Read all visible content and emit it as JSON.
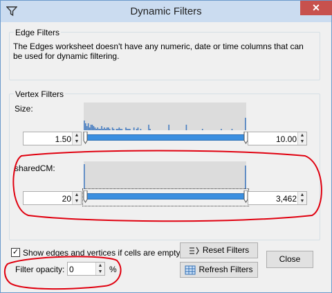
{
  "window": {
    "title": "Dynamic Filters",
    "filter_icon": "filter-icon",
    "close_icon": "close-icon",
    "close_glyph": "✕"
  },
  "edge_filters": {
    "title": "Edge Filters",
    "message_line1": "The Edges worksheet doesn't have any numeric, date or time columns that can",
    "message_line2": "be used for dynamic filtering."
  },
  "vertex_filters": {
    "title": "Vertex Filters",
    "filters": [
      {
        "label": "Size:",
        "min_value": "1.50",
        "max_value": "10.00",
        "range_low": 0,
        "range_high": 1,
        "histogram": [
          0.35,
          0.25,
          0.15,
          0.25,
          0.1,
          0.2,
          0.2,
          0.15,
          0.1,
          0.05,
          0.1,
          0.05,
          0.05,
          0.15,
          0.05,
          0.1,
          0.05,
          0.1,
          0.1,
          0.05,
          0,
          0.1,
          0.05,
          0,
          0.05,
          0.05,
          0.1,
          0.05,
          0.05,
          0,
          0,
          0.1,
          0.05,
          0.05,
          0.05,
          0,
          0,
          0.1,
          0,
          0.05,
          0.1,
          0,
          0.05,
          0,
          0,
          0,
          0,
          0,
          0.2,
          0.05,
          0,
          0,
          0,
          0,
          0,
          0,
          0,
          0,
          0,
          0,
          0,
          0,
          0,
          0.2,
          0,
          0,
          0,
          0,
          0,
          0,
          0,
          0,
          0,
          0,
          0,
          0,
          0.2,
          0,
          0,
          0,
          0,
          0,
          0,
          0,
          0,
          0,
          0,
          0,
          0.05,
          0,
          0,
          0,
          0,
          0,
          0,
          0,
          0,
          0,
          0,
          0,
          0,
          0,
          0.05,
          0,
          0,
          0,
          0,
          0,
          0,
          0,
          0.05,
          0,
          0,
          0,
          0,
          0,
          0,
          0,
          0,
          0,
          0.45
        ]
      },
      {
        "label": "sharedCM:",
        "min_value": "20",
        "max_value": "3,462",
        "range_low": 0,
        "range_high": 1,
        "histogram": [
          0.9,
          0,
          0,
          0,
          0,
          0,
          0,
          0,
          0,
          0,
          0,
          0,
          0,
          0,
          0,
          0,
          0,
          0,
          0,
          0,
          0,
          0,
          0,
          0,
          0,
          0,
          0,
          0,
          0,
          0,
          0,
          0,
          0,
          0,
          0,
          0,
          0,
          0,
          0,
          0,
          0,
          0,
          0,
          0,
          0,
          0,
          0,
          0,
          0,
          0,
          0,
          0,
          0,
          0,
          0,
          0,
          0,
          0,
          0,
          0,
          0,
          0,
          0,
          0,
          0,
          0,
          0,
          0,
          0,
          0,
          0,
          0,
          0,
          0,
          0,
          0,
          0,
          0,
          0,
          0,
          0,
          0,
          0,
          0,
          0,
          0,
          0,
          0,
          0,
          0,
          0,
          0,
          0,
          0,
          0,
          0,
          0,
          0,
          0,
          0,
          0,
          0,
          0,
          0,
          0,
          0,
          0,
          0,
          0,
          0,
          0,
          0,
          0,
          0,
          0,
          0,
          0,
          0,
          0,
          0.85
        ]
      }
    ]
  },
  "footer": {
    "show_empty_label": "Show edges and vertices if cells are empty",
    "show_empty_checked": true,
    "opacity_label": "Filter opacity:",
    "opacity_value": "0",
    "opacity_unit": "%",
    "reset_label": "Reset Filters",
    "refresh_label": "Refresh Filters",
    "close_label": "Close"
  },
  "colors": {
    "accent": "#3b8fe0",
    "histogram_bar": "#4a7fc1",
    "annotation": "#e0000f"
  }
}
